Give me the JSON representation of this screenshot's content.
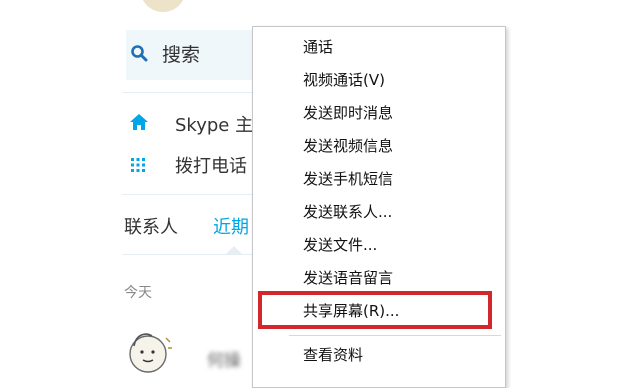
{
  "sidebar": {
    "search_label": "搜索",
    "nav": [
      {
        "label": "Skype 主",
        "icon": "home-icon"
      },
      {
        "label": "拨打电话",
        "icon": "dialpad-icon"
      }
    ],
    "tabs": [
      {
        "label": "联系人"
      },
      {
        "label": "近期"
      }
    ],
    "section_label": "今天",
    "contact_name": "何操"
  },
  "menu": {
    "items": [
      {
        "label": "通话"
      },
      {
        "label": "视频通话(V)"
      },
      {
        "label": "发送即时消息"
      },
      {
        "label": "发送视频信息"
      },
      {
        "label": "发送手机短信"
      },
      {
        "label": "发送联系人..."
      },
      {
        "label": "发送文件..."
      },
      {
        "label": "发送语音留言"
      },
      {
        "label": "共享屏幕(R)..."
      },
      {
        "label": "查看资料"
      }
    ]
  },
  "colors": {
    "accent": "#00a6e6",
    "highlight_border": "#d1272d"
  }
}
